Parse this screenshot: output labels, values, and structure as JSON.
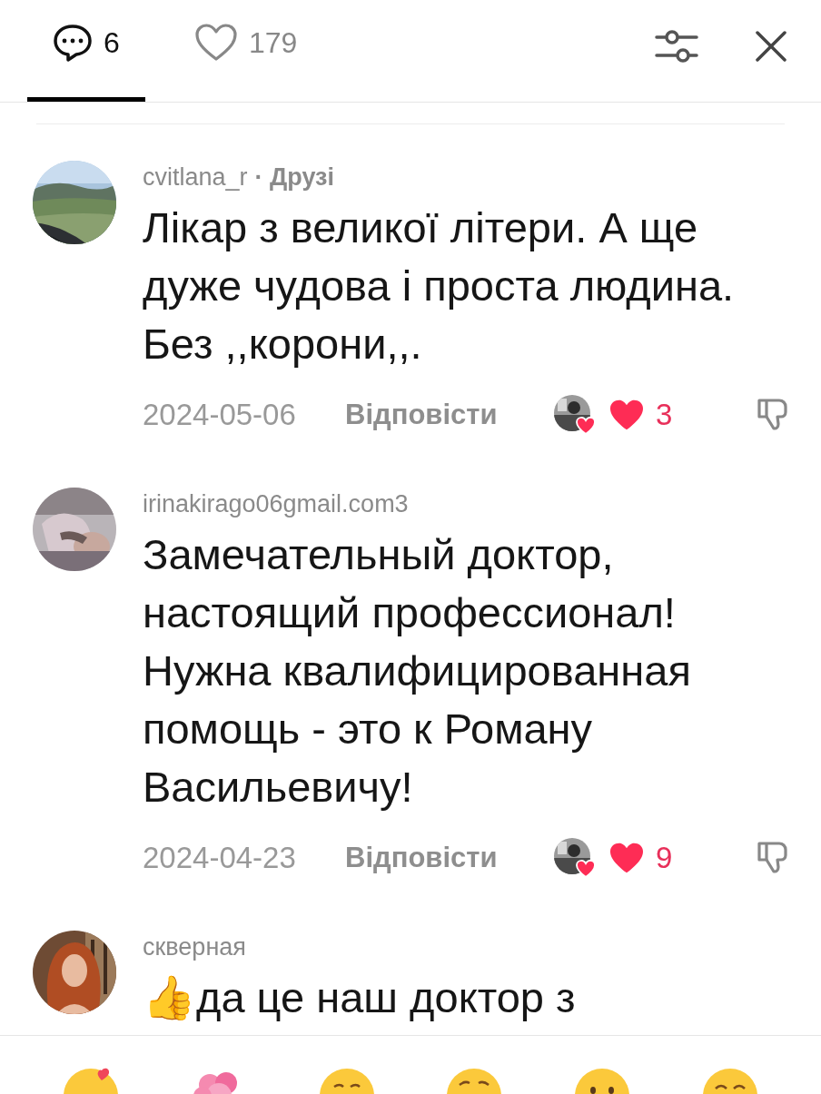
{
  "tabs": [
    {
      "kind": "comments",
      "count": "6",
      "selected": true
    },
    {
      "kind": "likes",
      "count": "179",
      "selected": false
    }
  ],
  "comments": [
    {
      "username": "cvitlana_r",
      "tag": "· Друзі",
      "text": "Лікар з великої літери. А ще дуже чудова і проста людина. Без ,,корони,,.",
      "date": "2024-05-06",
      "reply": "Відповісти",
      "liked_by_creator": true,
      "liked": true,
      "likes": "3"
    },
    {
      "username": "irinakirago06gmail.com3",
      "text": "Замечательный доктор, настоящий профессионал! Нужна квалифицированная помощь - это к Роману Васильевичу!",
      "date": "2024-04-23",
      "reply": "Відповісти",
      "liked_by_creator": true,
      "liked": true,
      "likes": "9"
    },
    {
      "username": "скверная",
      "text": "👍да це наш доктор з"
    }
  ]
}
